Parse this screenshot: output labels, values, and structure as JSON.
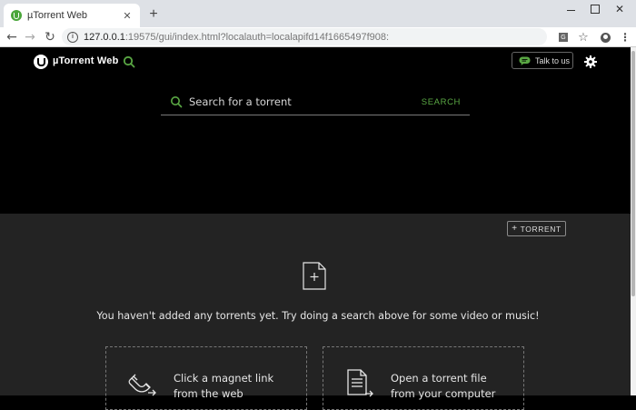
{
  "browser": {
    "tab_title": "µTorrent Web",
    "tab_close": "✕",
    "new_tab": "+",
    "url_host": "127.0.0.1",
    "url_rest": ":19575/gui/index.html?localauth=localapifd14f1665497f908:"
  },
  "header": {
    "logo_text": "µTorrent Web",
    "talk_label": "Talk to us"
  },
  "search": {
    "placeholder": "Search for a torrent",
    "button_label": "SEARCH"
  },
  "main": {
    "add_torrent_plus": "+",
    "add_torrent_label": "TORRENT",
    "empty_message": "You haven't added any torrents yet. Try doing a search above for some video or music!",
    "cards": [
      {
        "line1": "Click a magnet link",
        "line2": "from the web"
      },
      {
        "line1": "Open a torrent file",
        "line2": "from your computer"
      }
    ]
  },
  "colors": {
    "accent_green": "#5aa844",
    "header_bg": "#000000",
    "main_bg": "#232323"
  },
  "icons": [
    "utorrent-logo-icon",
    "search-icon",
    "chat-icon",
    "gear-icon",
    "file-plus-icon",
    "magnet-icon",
    "document-icon"
  ]
}
